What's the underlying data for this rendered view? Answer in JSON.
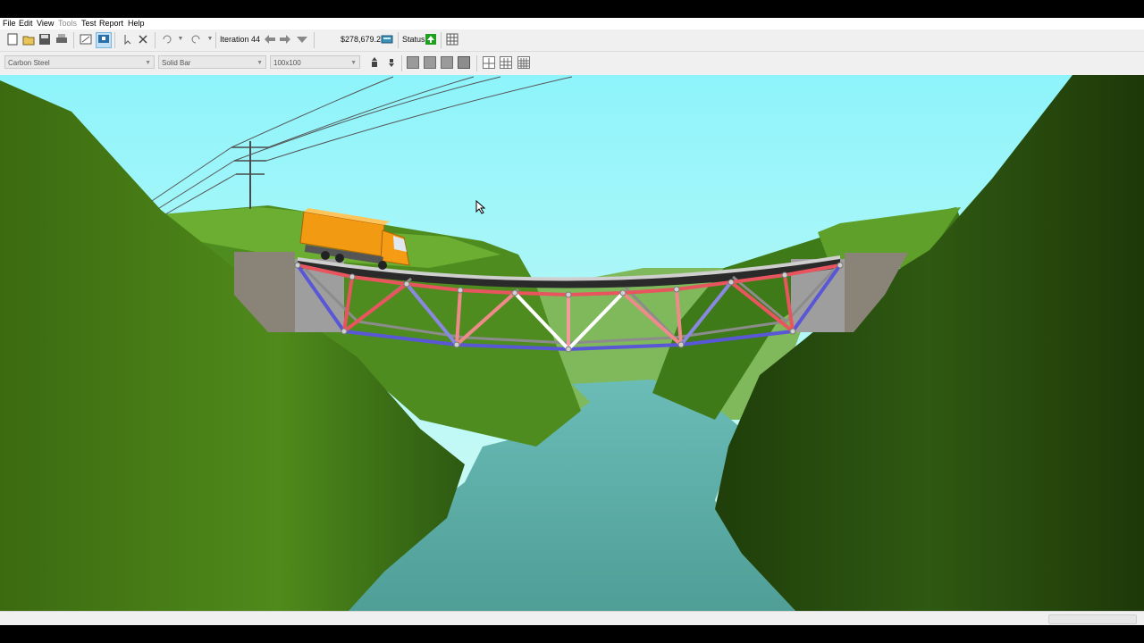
{
  "menu": {
    "file": "File",
    "edit": "Edit",
    "view": "View",
    "tools": "Tools",
    "test": "Test",
    "report": "Report",
    "help": "Help"
  },
  "toolbar": {
    "iteration_label": "Iteration 44",
    "cost": "$278,679.23",
    "status_label": "Status:"
  },
  "materials": {
    "material": "Carbon Steel",
    "section": "Solid Bar",
    "size": "100x100"
  },
  "icons": {
    "new": "new-file-icon",
    "open": "open-folder-icon",
    "save": "save-icon",
    "print": "print-icon",
    "drawing_board": "drawing-board-icon",
    "load_test": "load-test-icon",
    "select": "select-icon",
    "delete": "delete-icon",
    "undo": "undo-icon",
    "redo": "redo-icon",
    "back": "back-arrow-icon",
    "forward": "forward-arrow-icon",
    "iteration_menu": "iteration-dropdown-icon",
    "calculator": "calculator-icon",
    "status_ok": "status-ok-icon",
    "report_table": "report-table-icon"
  },
  "colors": {
    "tension": "#e8555e",
    "compression": "#5a57d6",
    "sky_top": "#8ef4fb",
    "water": "#57a6a0",
    "truck": "#f29a12",
    "status_ok": "#1ea01e"
  }
}
